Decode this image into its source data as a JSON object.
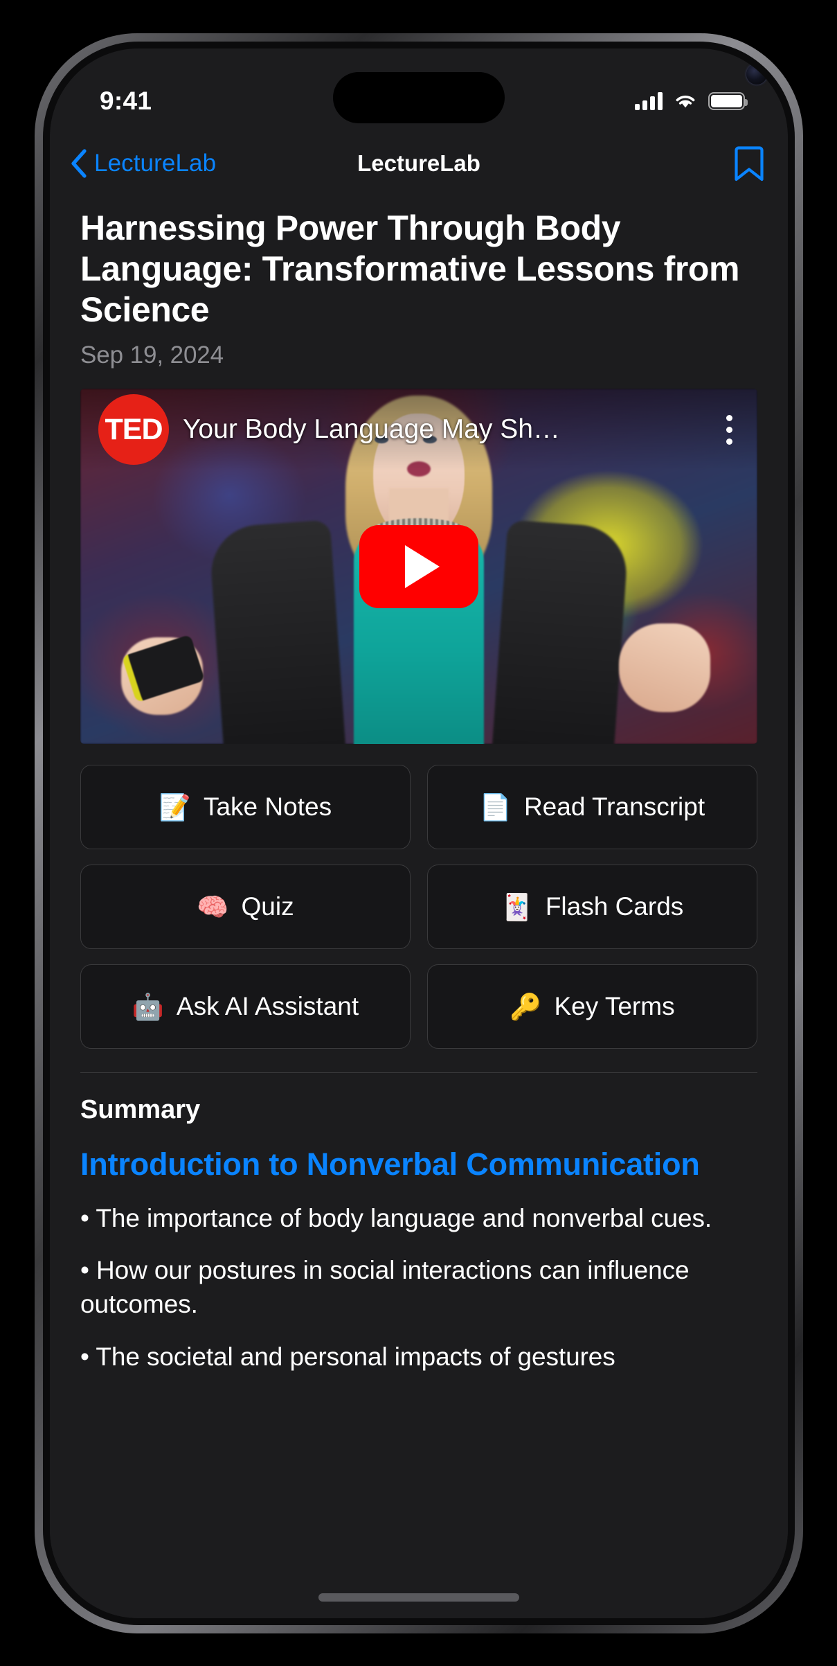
{
  "status_bar": {
    "time": "9:41",
    "icons": [
      "cellular-signal-icon",
      "wifi-icon",
      "battery-icon"
    ]
  },
  "nav_bar": {
    "back_label": "LectureLab",
    "back_icon": "chevron-left-icon",
    "title": "LectureLab",
    "bookmark_icon": "bookmark-icon",
    "accent_color": "#0a84ff"
  },
  "lecture": {
    "title": "Harnessing Power Through Body Language: Transformative Lessons from Science",
    "date": "Sep 19, 2024"
  },
  "video": {
    "channel_logo_text": "TED",
    "title": "Your Body Language May Sh…",
    "menu_icon": "kebab-menu-icon",
    "play_icon": "play-button-icon",
    "play_button_color": "#ff0000",
    "logo_color": "#e62117"
  },
  "actions": [
    {
      "emoji": "📝",
      "icon_name": "memo-icon",
      "label": "Take Notes"
    },
    {
      "emoji": "📄",
      "icon_name": "page-facing-up-icon",
      "label": "Read Transcript"
    },
    {
      "emoji": "🧠",
      "icon_name": "brain-icon",
      "label": "Quiz"
    },
    {
      "emoji": "🃏",
      "icon_name": "joker-card-icon",
      "label": "Flash Cards"
    },
    {
      "emoji": "🤖",
      "icon_name": "robot-icon",
      "label": "Ask AI Assistant"
    },
    {
      "emoji": "🔑",
      "icon_name": "key-icon",
      "label": "Key Terms"
    }
  ],
  "summary": {
    "heading": "Summary",
    "subheading": "Introduction to Nonverbal Communication",
    "bullets": [
      "• The importance of body language and nonverbal cues.",
      "• How our postures in social interactions can influence outcomes.",
      "• The societal and personal impacts of gestures"
    ]
  }
}
